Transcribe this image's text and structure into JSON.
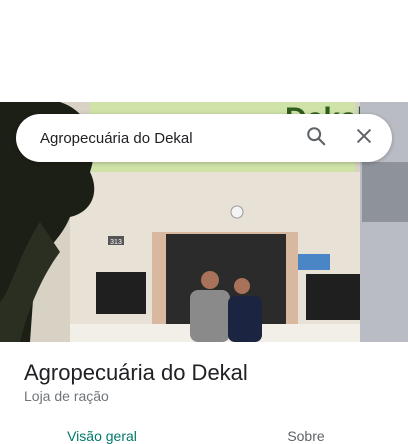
{
  "search": {
    "query": "Agropecuária do Dekal",
    "search_icon": "search-icon",
    "close_icon": "close-icon"
  },
  "photo": {
    "sign_text": "Agropecuária do Dekal",
    "sign_partial": "Dekal",
    "house_number": "313",
    "colors": {
      "wall": "#e8e2d6",
      "door": "#2b2b2b",
      "sign": "#cfe3a8",
      "tree": "#1c1f16"
    }
  },
  "place": {
    "title": "Agropecuária do Dekal",
    "category": "Loja de ração"
  },
  "tabs": [
    {
      "label": "Visão geral",
      "active": true
    },
    {
      "label": "Sobre",
      "active": false
    }
  ],
  "colors": {
    "accent": "#00796b",
    "text_primary": "#202124",
    "text_secondary": "#70757a"
  }
}
